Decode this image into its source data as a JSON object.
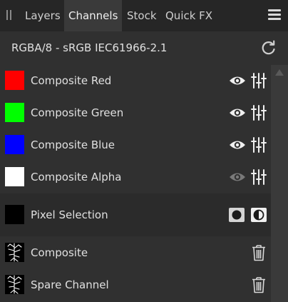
{
  "tabs": [
    {
      "label": "Layers",
      "active": false
    },
    {
      "label": "Channels",
      "active": true
    },
    {
      "label": "Stock",
      "active": false
    },
    {
      "label": "Quick FX",
      "active": false
    }
  ],
  "profile": {
    "label": "RGBA/8 - sRGB IEC61966-2.1"
  },
  "composite_channels": [
    {
      "label": "Composite Red",
      "color": "#ff0000",
      "visible": true
    },
    {
      "label": "Composite Green",
      "color": "#00ff00",
      "visible": true
    },
    {
      "label": "Composite Blue",
      "color": "#0000ff",
      "visible": true
    },
    {
      "label": "Composite Alpha",
      "color": "#ffffff",
      "visible": false
    }
  ],
  "pixel_selection": {
    "label": "Pixel Selection",
    "color": "#000000"
  },
  "spare_channels": [
    {
      "label": "Composite"
    },
    {
      "label": "Spare Channel"
    }
  ],
  "colors": {
    "background": "#303030",
    "tabbar": "#262626",
    "active_tab": "#3a3a3a",
    "text": "#e0e0e0"
  }
}
